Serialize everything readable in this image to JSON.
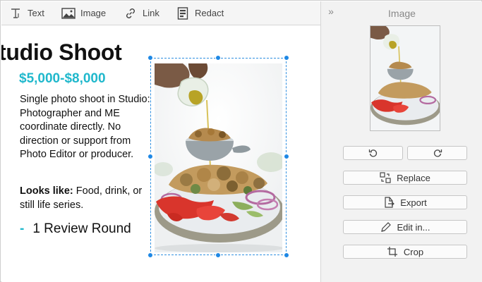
{
  "toolbar": {
    "text_label": "Text",
    "image_label": "Image",
    "link_label": "Link",
    "redact_label": "Redact"
  },
  "document": {
    "title": "tudio Shoot",
    "price": "$5,000-$8,000",
    "description": "Single photo shoot  in Studio: Photographer and ME coordinate directly. No direction or support from Photo Editor or producer.",
    "looks_like_label": "Looks like:",
    "looks_like_value": " Food, drink, or still life series.",
    "review_dash": "-",
    "review_text": "1 Review Round"
  },
  "panel": {
    "collapse_glyph": "»",
    "title": "Image",
    "replace_label": "Replace",
    "export_label": "Export",
    "edit_label": "Edit in...",
    "crop_label": "Crop"
  },
  "colors": {
    "accent": "#20b8cc",
    "selection": "#1e88e5"
  },
  "icons": {
    "text": "text-icon",
    "image": "image-icon",
    "link": "link-icon",
    "redact": "redact-icon",
    "rotate_left": "rotate-left-icon",
    "rotate_right": "rotate-right-icon",
    "replace": "replace-icon",
    "export": "export-icon",
    "edit": "pencil-icon",
    "crop": "crop-icon"
  }
}
